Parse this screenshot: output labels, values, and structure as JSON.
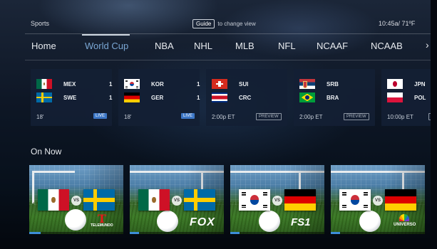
{
  "header": {
    "section_title": "Sports",
    "guide_key": "Guide",
    "guide_hint": "to change view",
    "clock": "10:45a/ 71ºF"
  },
  "tabs": [
    {
      "label": "Home"
    },
    {
      "label": "World Cup",
      "active": true
    },
    {
      "label": "NBA"
    },
    {
      "label": "NHL"
    },
    {
      "label": "MLB"
    },
    {
      "label": "NFL"
    },
    {
      "label": "NCAAF"
    },
    {
      "label": "NCAAB"
    }
  ],
  "tab_scroll_icon": "chevron-right-icon",
  "scores": [
    {
      "team1": {
        "abbr": "MEX",
        "flag": "mexico-flag",
        "score": "1"
      },
      "team2": {
        "abbr": "SWE",
        "flag": "sweden-flag",
        "score": "1"
      },
      "time": "18'",
      "status": "LIVE"
    },
    {
      "team1": {
        "abbr": "KOR",
        "flag": "south-korea-flag",
        "score": "1"
      },
      "team2": {
        "abbr": "GER",
        "flag": "germany-flag",
        "score": "1"
      },
      "time": "18'",
      "status": "LIVE"
    },
    {
      "team1": {
        "abbr": "SUI",
        "flag": "switzerland-flag",
        "score": ""
      },
      "team2": {
        "abbr": "CRC",
        "flag": "costa-rica-flag",
        "score": ""
      },
      "time": "2:00p ET",
      "status": "PREVIEW"
    },
    {
      "team1": {
        "abbr": "SRB",
        "flag": "serbia-flag",
        "score": ""
      },
      "team2": {
        "abbr": "BRA",
        "flag": "brazil-flag",
        "score": ""
      },
      "time": "2:00p ET",
      "status": "PREVIEW"
    },
    {
      "team1": {
        "abbr": "JPN",
        "flag": "japan-flag",
        "score": ""
      },
      "team2": {
        "abbr": "POL",
        "flag": "poland-flag",
        "score": ""
      },
      "time": "10:00p ET",
      "status": "P"
    }
  ],
  "on_now": {
    "heading": "On Now",
    "vs_label": "VS",
    "tiles": [
      {
        "left_flag": "mexico-flag",
        "right_flag": "sweden-flag",
        "network": "TELEMUNDO",
        "network_mark": "T",
        "progress": 0.12
      },
      {
        "left_flag": "mexico-flag",
        "right_flag": "sweden-flag",
        "network": "FOX",
        "progress": 0.1
      },
      {
        "left_flag": "south-korea-flag",
        "right_flag": "germany-flag",
        "network": "FS1",
        "progress": 0.1
      },
      {
        "left_flag": "south-korea-flag",
        "right_flag": "germany-flag",
        "network": "UNIVERSO",
        "progress": 0.1
      }
    ]
  },
  "colors": {
    "accent": "#3d77c6",
    "active_tab": "#7aa7d4",
    "card_bg": "#142034",
    "progress": "#3d8ed8"
  }
}
